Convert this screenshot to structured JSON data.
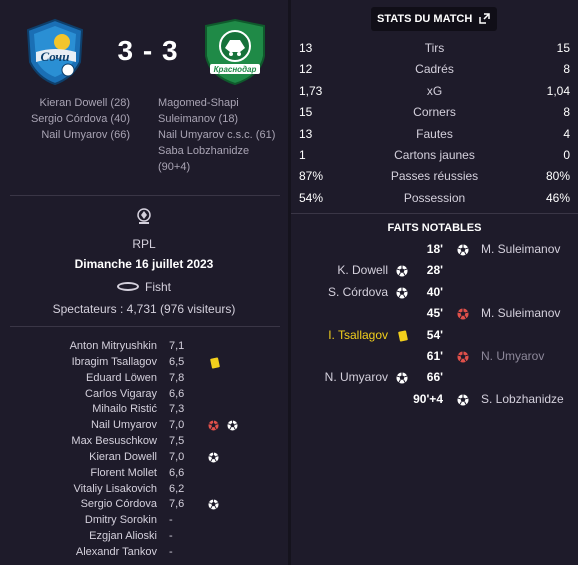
{
  "header": {
    "home_score": 3,
    "away_score": 3,
    "separator": "-",
    "away_logo_text": "Краснодар",
    "home_scorers": [
      "Kieran Dowell (28)",
      "Sergio Córdova (40)",
      "Nail Umyarov (66)"
    ],
    "away_scorers": [
      "Magomed-Shapi",
      "Suleimanov (18)",
      "Nail Umyarov c.s.c. (61)",
      "Saba Lobzhanidze",
      "(90+4)"
    ]
  },
  "match_info": {
    "competition": "RPL",
    "date": "Dimanche 16 juillet 2023",
    "venue": "Fisht",
    "attendance": "Spectateurs : 4,731 (976 visiteurs)"
  },
  "players": [
    {
      "name": "Anton Mitryushkin",
      "rating": "7,1",
      "icons": []
    },
    {
      "name": "Ibragim Tsallagov",
      "rating": "6,5",
      "icons": [
        "yellow-card"
      ]
    },
    {
      "name": "Eduard Löwen",
      "rating": "7,8",
      "icons": []
    },
    {
      "name": "Carlos Vigaray",
      "rating": "6,6",
      "icons": []
    },
    {
      "name": "Mihailo Ristić",
      "rating": "7,3",
      "icons": []
    },
    {
      "name": "Nail Umyarov",
      "rating": "7,0",
      "icons": [
        "own-goal",
        "goal"
      ]
    },
    {
      "name": "Max Besuschkow",
      "rating": "7,5",
      "icons": []
    },
    {
      "name": "Kieran Dowell",
      "rating": "7,0",
      "icons": [
        "goal"
      ]
    },
    {
      "name": "Florent Mollet",
      "rating": "6,6",
      "icons": []
    },
    {
      "name": "Vitaliy Lisakovich",
      "rating": "6,2",
      "icons": []
    },
    {
      "name": "Sergio Córdova",
      "rating": "7,6",
      "icons": [
        "goal"
      ]
    },
    {
      "name": "Dmitry Sorokin",
      "rating": "-",
      "icons": []
    },
    {
      "name": "Ezgjan Alioski",
      "rating": "-",
      "icons": []
    },
    {
      "name": "Alexandr Tankov",
      "rating": "-",
      "icons": []
    }
  ],
  "stats": {
    "title": "STATS DU MATCH",
    "rows": [
      {
        "home": "13",
        "label": "Tirs",
        "away": "15"
      },
      {
        "home": "12",
        "label": "Cadrés",
        "away": "8"
      },
      {
        "home": "1,73",
        "label": "xG",
        "away": "1,04"
      },
      {
        "home": "15",
        "label": "Corners",
        "away": "8"
      },
      {
        "home": "13",
        "label": "Fautes",
        "away": "4"
      },
      {
        "home": "1",
        "label": "Cartons jaunes",
        "away": "0"
      },
      {
        "home": "87%",
        "label": "Passes réussies",
        "away": "80%"
      },
      {
        "home": "54%",
        "label": "Possession",
        "away": "46%"
      }
    ]
  },
  "events": {
    "title": "FAITS NOTABLES",
    "rows": [
      {
        "minute": "18'",
        "side": "away",
        "name": "M. Suleimanov",
        "type": "goal"
      },
      {
        "minute": "28'",
        "side": "home",
        "name": "K. Dowell",
        "type": "goal"
      },
      {
        "minute": "40'",
        "side": "home",
        "name": "S. Córdova",
        "type": "goal"
      },
      {
        "minute": "45'",
        "side": "away",
        "name": "M. Suleimanov",
        "type": "own-goal"
      },
      {
        "minute": "54'",
        "side": "home",
        "name": "I. Tsallagov",
        "type": "yellow-card"
      },
      {
        "minute": "61'",
        "side": "away",
        "name": "N. Umyarov",
        "type": "own-goal"
      },
      {
        "minute": "66'",
        "side": "home",
        "name": "N. Umyarov",
        "type": "goal"
      },
      {
        "minute": "90'+4",
        "side": "away",
        "name": "S. Lobzhanidze",
        "type": "goal"
      }
    ]
  },
  "colors": {
    "background": "#1e1b2a",
    "yellow_card": "#f2cf1c",
    "own_goal": "#e0504a",
    "home_primary": "#2a8fd4",
    "away_primary": "#1f8a47"
  }
}
